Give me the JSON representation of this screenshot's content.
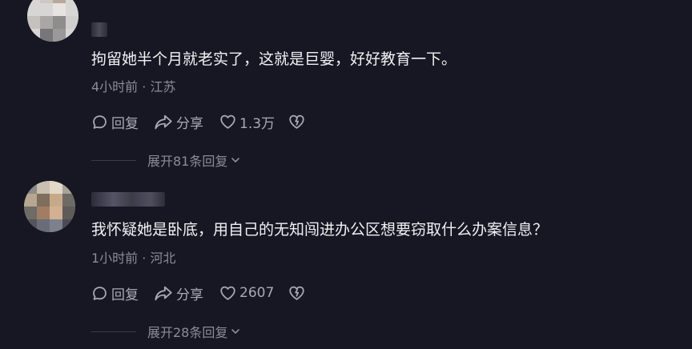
{
  "comments": [
    {
      "text": "拘留她半个月就老实了，这就是巨婴，好好教育一下。",
      "time": "4小时前",
      "separator": "·",
      "location": "江苏",
      "reply_label": "回复",
      "share_label": "分享",
      "like_count": "1.3万",
      "expand_label": "展开81条回复"
    },
    {
      "text": "我怀疑她是卧底，用自己的无知闯进办公区想要窃取什么办案信息？",
      "time": "1小时前",
      "separator": "·",
      "location": "河北",
      "reply_label": "回复",
      "share_label": "分享",
      "like_count": "2607",
      "expand_label": "展开28条回复"
    }
  ],
  "colors": {
    "background": "#161723",
    "text": "#f1f1f4",
    "meta": "#8b8c96",
    "action": "#a9aab3"
  },
  "icons": [
    "reply-icon",
    "share-icon",
    "heart-icon",
    "dislike-icon",
    "chevron-down-icon"
  ]
}
